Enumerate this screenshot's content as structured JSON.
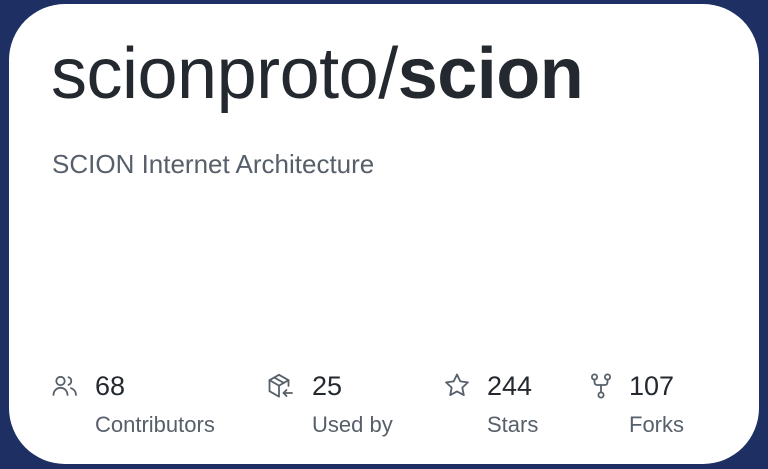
{
  "repo": {
    "owner": "scionproto/",
    "name": "scion",
    "description": "SCION Internet Architecture"
  },
  "stats": {
    "contributors": {
      "icon": "people-icon",
      "value": "68",
      "label": "Contributors"
    },
    "used_by": {
      "icon": "package-dependents-icon",
      "value": "25",
      "label": "Used by"
    },
    "stars": {
      "icon": "star-icon",
      "value": "244",
      "label": "Stars"
    },
    "forks": {
      "icon": "repo-forked-icon",
      "value": "107",
      "label": "Forks"
    }
  },
  "colors": {
    "background": "#1e2f63",
    "card": "#ffffff",
    "text_primary": "#24292f",
    "text_secondary": "#57606a"
  }
}
